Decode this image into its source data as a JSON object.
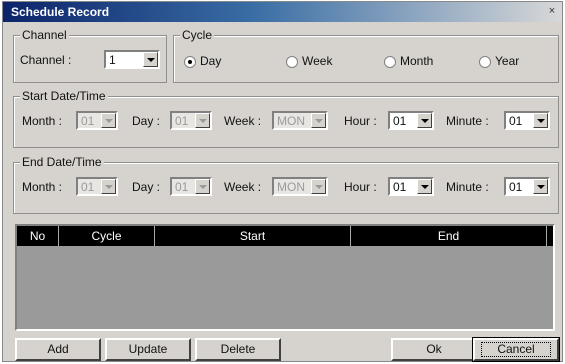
{
  "window": {
    "title": "Schedule Record",
    "close_glyph": "×"
  },
  "channel": {
    "legend": "Channel",
    "label": "Channel :",
    "value": "1"
  },
  "cycle": {
    "legend": "Cycle",
    "options": [
      {
        "label": "Day",
        "selected": true
      },
      {
        "label": "Week",
        "selected": false
      },
      {
        "label": "Month",
        "selected": false
      },
      {
        "label": "Year",
        "selected": false
      }
    ]
  },
  "start": {
    "legend": "Start Date/Time",
    "month_label": "Month :",
    "month_value": "01",
    "day_label": "Day :",
    "day_value": "01",
    "week_label": "Week :",
    "week_value": "MON",
    "hour_label": "Hour :",
    "hour_value": "01",
    "minute_label": "Minute :",
    "minute_value": "01"
  },
  "end": {
    "legend": "End Date/Time",
    "month_label": "Month :",
    "month_value": "01",
    "day_label": "Day :",
    "day_value": "01",
    "week_label": "Week :",
    "week_value": "MON",
    "hour_label": "Hour :",
    "hour_value": "01",
    "minute_label": "Minute :",
    "minute_value": "01"
  },
  "table": {
    "columns": [
      "No",
      "Cycle",
      "Start",
      "End"
    ],
    "rows": []
  },
  "buttons": {
    "add": "Add",
    "update": "Update",
    "delete": "Delete",
    "ok": "Ok",
    "cancel": "Cancel"
  }
}
